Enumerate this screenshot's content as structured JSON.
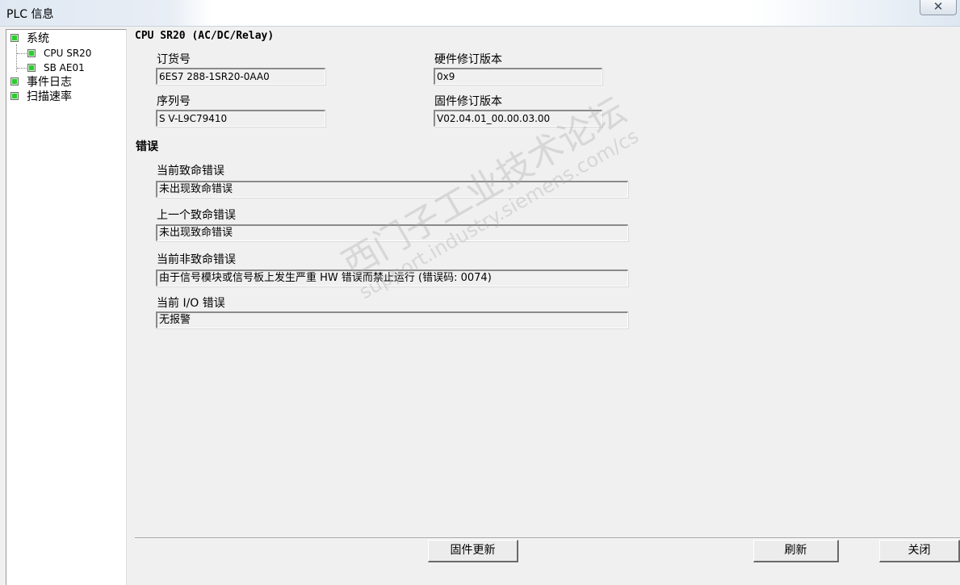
{
  "window": {
    "title": "PLC 信息",
    "close_glyph": "✕"
  },
  "tree": {
    "items": [
      {
        "label": "系统",
        "icon": "status-ok-icon"
      },
      {
        "label": "CPU SR20",
        "icon": "status-ok-icon"
      },
      {
        "label": "SB AE01",
        "icon": "status-ok-icon"
      },
      {
        "label": "事件日志",
        "icon": "status-ok-icon"
      },
      {
        "label": "扫描速率",
        "icon": "status-ok-icon"
      }
    ]
  },
  "device": {
    "heading": "CPU SR20 (AC/DC/Relay)",
    "order_number_label": "订货号",
    "order_number": "6ES7 288-1SR20-0AA0",
    "hw_revision_label": "硬件修订版本",
    "hw_revision": "0x9",
    "serial_label": "序列号",
    "serial": "S V-L9C79410",
    "fw_revision_label": "固件修订版本",
    "fw_revision": "V02.04.01_00.00.03.00"
  },
  "errors": {
    "title": "错误",
    "current_fatal_label": "当前致命错误",
    "current_fatal": "未出现致命错误",
    "previous_fatal_label": "上一个致命错误",
    "previous_fatal": "未出现致命错误",
    "current_nonfatal_label": "当前非致命错误",
    "current_nonfatal": "由于信号模块或信号板上发生严重 HW 错误而禁止运行 (错误码: 0074)",
    "io_error_label": "当前 I/O 错误",
    "io_error": "无报警"
  },
  "buttons": {
    "firmware_update": "固件更新",
    "refresh": "刷新",
    "close": "关闭"
  },
  "watermark": {
    "line1": "西门子工业技术论坛",
    "line2": "support.industry.siemens.com/cs"
  },
  "colors": {
    "status_ok": "#2fcb2f",
    "window_bg": "#f0f0f0"
  }
}
